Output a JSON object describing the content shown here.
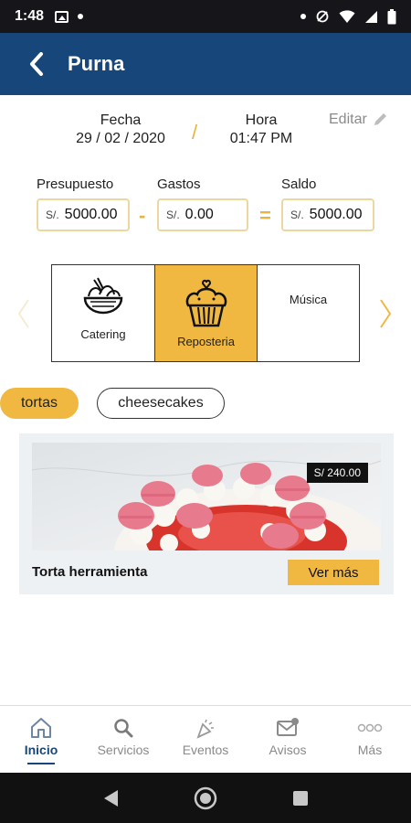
{
  "status_bar": {
    "time": "1:48"
  },
  "header": {
    "title": "Purna"
  },
  "datetime": {
    "date_label": "Fecha",
    "date_value": "29 / 02 / 2020",
    "separator": "/",
    "time_label": "Hora",
    "time_value": "01:47 PM",
    "edit_label": "Editar"
  },
  "budget": {
    "presupuesto": {
      "label": "Presupuesto",
      "currency": "S/.",
      "value": "5000.00"
    },
    "minus": "-",
    "gastos": {
      "label": "Gastos",
      "currency": "S/.",
      "value": "0.00"
    },
    "equals": "=",
    "saldo": {
      "label": "Saldo",
      "currency": "S/.",
      "value": "5000.00"
    }
  },
  "categories": [
    {
      "label": "Catering",
      "icon": "salad-bowl-icon",
      "active": false
    },
    {
      "label": "Reposteria",
      "icon": "cupcake-icon",
      "active": true
    },
    {
      "label": "Música",
      "icon": "",
      "active": false
    }
  ],
  "chips": [
    {
      "label": "tortas",
      "active": true
    },
    {
      "label": "cheesecakes",
      "active": false
    }
  ],
  "product": {
    "price": "S/ 240.00",
    "name": "Torta herramienta",
    "cta": "Ver más"
  },
  "bottom_nav": [
    {
      "label": "Inicio",
      "icon": "home-icon",
      "active": true
    },
    {
      "label": "Servicios",
      "icon": "search-icon",
      "active": false
    },
    {
      "label": "Eventos",
      "icon": "party-popper-icon",
      "active": false
    },
    {
      "label": "Avisos",
      "icon": "mail-alert-icon",
      "active": false
    },
    {
      "label": "Más",
      "icon": "more-dots-icon",
      "active": false
    }
  ],
  "colors": {
    "primary": "#17467a",
    "accent": "#f0b840",
    "status_bar": "#16161a"
  }
}
